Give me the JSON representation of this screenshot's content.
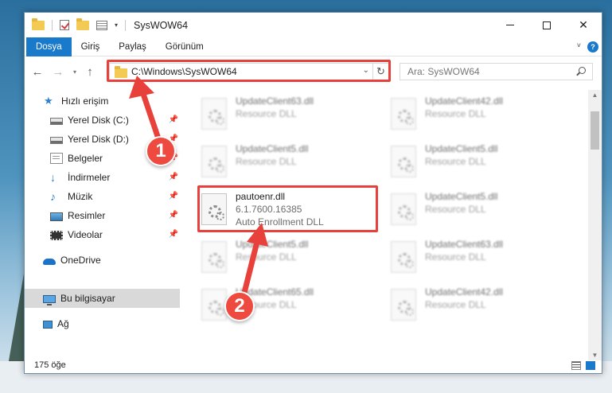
{
  "window": {
    "title": "SysWOW64",
    "controls": {
      "minimize": "—",
      "maximize": "☐",
      "close": "✕"
    }
  },
  "ribbon": {
    "tabs": [
      {
        "label": "Dosya",
        "active": true
      },
      {
        "label": "Giriş",
        "active": false
      },
      {
        "label": "Paylaş",
        "active": false
      },
      {
        "label": "Görünüm",
        "active": false
      }
    ],
    "help": "?"
  },
  "navigation": {
    "back": "←",
    "forward": "→",
    "recent": "▾",
    "up": "↑"
  },
  "address": {
    "path": "C:\\Windows\\SysWOW64",
    "refresh": "↻"
  },
  "search": {
    "placeholder": "Ara: SysWOW64"
  },
  "sidebar": {
    "items": [
      {
        "label": "Hızlı erişim",
        "icon": "star-icon",
        "pinned": false
      },
      {
        "label": "Yerel Disk (C:)",
        "icon": "drive-icon",
        "pinned": true
      },
      {
        "label": "Yerel Disk (D:)",
        "icon": "drive-icon",
        "pinned": true
      },
      {
        "label": "Belgeler",
        "icon": "documents-icon",
        "pinned": true
      },
      {
        "label": "İndirmeler",
        "icon": "downloads-icon",
        "pinned": true
      },
      {
        "label": "Müzik",
        "icon": "music-icon",
        "pinned": true
      },
      {
        "label": "Resimler",
        "icon": "pictures-icon",
        "pinned": true
      },
      {
        "label": "Videolar",
        "icon": "videos-icon",
        "pinned": true
      },
      {
        "label": "OneDrive",
        "icon": "onedrive-icon",
        "pinned": false
      },
      {
        "label": "Bu bilgisayar",
        "icon": "this-pc-icon",
        "pinned": false,
        "selected": true
      },
      {
        "label": "Ağ",
        "icon": "network-icon",
        "pinned": false
      }
    ],
    "pin_glyph": "📌"
  },
  "files": {
    "left_column": [
      {
        "name": "UpdateClient63.dll",
        "line2": "Resource DLL",
        "line3": ""
      },
      {
        "name": "UpdateClient5.dll",
        "line2": "Resource DLL",
        "line3": ""
      },
      {
        "name": "pautoenr.dll",
        "line2": "6.1.7600.16385",
        "line3": "Auto Enrollment DLL",
        "highlighted": true
      },
      {
        "name": "UpdateClient5.dll",
        "line2": "Resource DLL",
        "line3": ""
      },
      {
        "name": "UpdateClient65.dll",
        "line2": "Resource DLL",
        "line3": ""
      }
    ],
    "right_column": [
      {
        "name": "UpdateClient42.dll",
        "line2": "Resource DLL"
      },
      {
        "name": "UpdateClient5.dll",
        "line2": "Resource DLL"
      },
      {
        "name": "UpdateClient5.dll",
        "line2": "Resource DLL"
      },
      {
        "name": "UpdateClient63.dll",
        "line2": "Resource DLL"
      },
      {
        "name": "UpdateClient42.dll",
        "line2": "Resource DLL"
      }
    ]
  },
  "status": {
    "item_count": "175 öğe"
  },
  "annotations": {
    "badge_1": "1",
    "badge_2": "2",
    "color": "#e8403a"
  }
}
